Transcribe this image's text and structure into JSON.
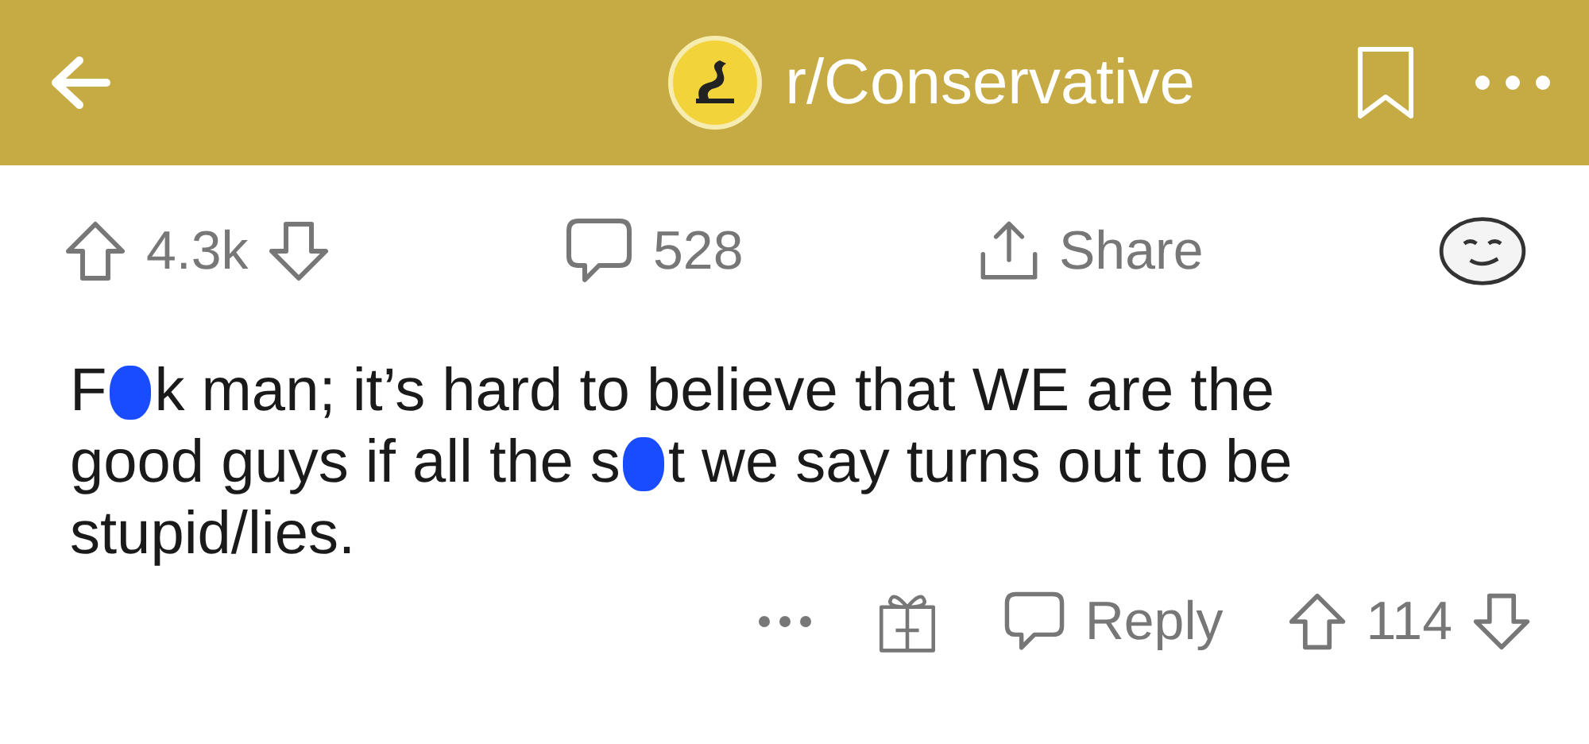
{
  "header": {
    "title": "r/Conservative"
  },
  "post_actions": {
    "score": "4.3k",
    "comments": "528",
    "share": "Share"
  },
  "comment": {
    "lines": [
      [
        {
          "kind": "text",
          "text": "F"
        },
        {
          "kind": "censor"
        },
        {
          "kind": "text",
          "text": "k man; it’s hard to believe that WE are the"
        }
      ],
      [
        {
          "kind": "text",
          "text": "good guys if all the s"
        },
        {
          "kind": "censor"
        },
        {
          "kind": "text",
          "text": "t we say turns out to be"
        }
      ],
      [
        {
          "kind": "text",
          "text": "stupid/lies."
        }
      ]
    ],
    "reply": "Reply",
    "score": "114"
  }
}
